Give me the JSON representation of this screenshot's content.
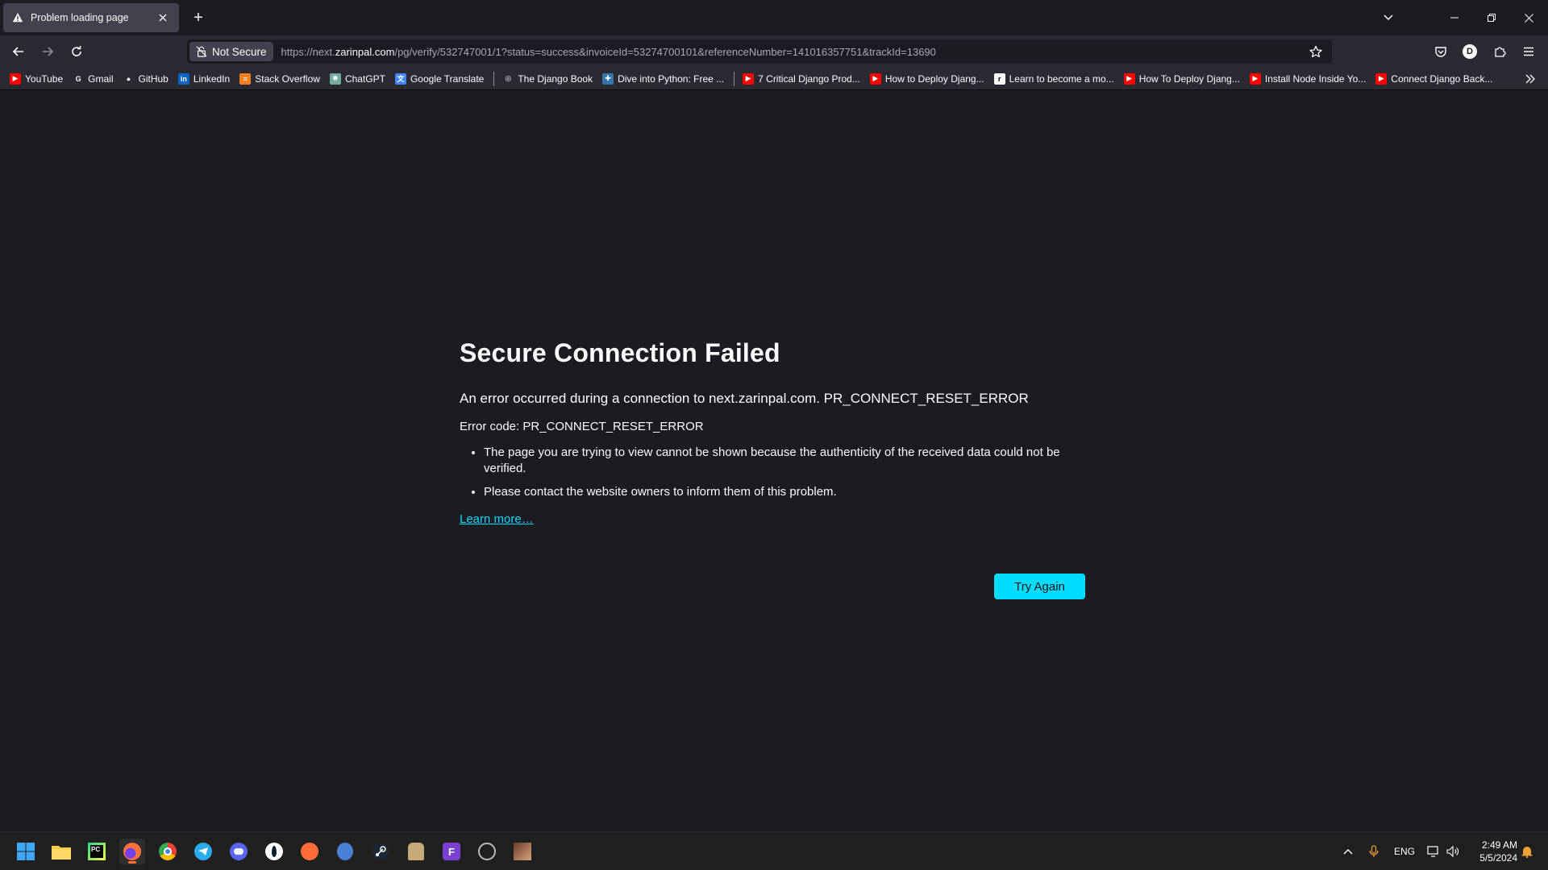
{
  "browser": {
    "tab_title": "Problem loading page",
    "new_tab_symbol": "+",
    "url_security_label": "Not Secure",
    "url_prefix": "https://next.",
    "url_host": "zarinpal.com",
    "url_path": "/pg/verify/532747001/1?status=success&invoiceId=53274700101&referenceNumber=141016357751&trackId=13690",
    "profile_initial": "D"
  },
  "bookmarks": [
    {
      "label": "YouTube",
      "icon": "youtube-icon",
      "color": "#ff0000"
    },
    {
      "label": "Gmail",
      "icon": "google-icon",
      "color": "#ffffff"
    },
    {
      "label": "GitHub",
      "icon": "github-icon",
      "color": "#ffffff"
    },
    {
      "label": "LinkedIn",
      "icon": "linkedin-icon",
      "color": "#0a66c2"
    },
    {
      "label": "Stack Overflow",
      "icon": "stackoverflow-icon",
      "color": "#f48024"
    },
    {
      "label": "ChatGPT",
      "icon": "chatgpt-icon",
      "color": "#74aa9c"
    },
    {
      "label": "Google Translate",
      "icon": "translate-icon",
      "color": "#4285f4"
    },
    {
      "label": "The Django Book",
      "icon": "globe-icon",
      "color": "#ffffff"
    },
    {
      "label": "Dive into Python: Free ...",
      "icon": "python-icon",
      "color": "#3776ab"
    },
    {
      "label": "7 Critical Django Prod...",
      "icon": "youtube-icon",
      "color": "#ff0000"
    },
    {
      "label": "How to Deploy Djang...",
      "icon": "youtube-icon",
      "color": "#ff0000"
    },
    {
      "label": "Learn to become a mo...",
      "icon": "roadmap-icon",
      "color": "#000000"
    },
    {
      "label": "How To Deploy Djang...",
      "icon": "youtube-icon",
      "color": "#ff0000"
    },
    {
      "label": "Install Node Inside Yo...",
      "icon": "youtube-icon",
      "color": "#ff0000"
    },
    {
      "label": "Connect Django Back...",
      "icon": "youtube-icon",
      "color": "#ff0000"
    }
  ],
  "error_page": {
    "title": "Secure Connection Failed",
    "description": "An error occurred during a connection to next.zarinpal.com. PR_CONNECT_RESET_ERROR",
    "error_code": "Error code: PR_CONNECT_RESET_ERROR",
    "bullets": [
      "The page you are trying to view cannot be shown because the authenticity of the received data could not be verified.",
      "Please contact the website owners to inform them of this problem."
    ],
    "learn_more": "Learn more…",
    "try_again": "Try Again",
    "accent_color": "#00ddff"
  },
  "taskbar": {
    "language": "ENG",
    "time": "2:49 AM",
    "date": "5/5/2024"
  }
}
